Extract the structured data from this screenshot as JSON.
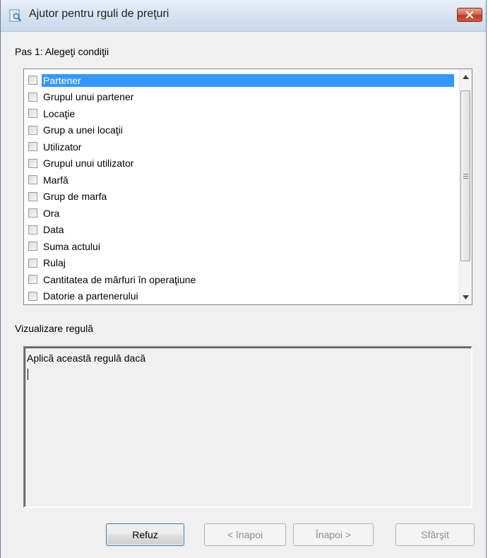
{
  "window": {
    "title": "Ajutor pentru rguli de preţuri"
  },
  "step": {
    "label": "Pas 1: Alegeţi condiţii"
  },
  "conditions": {
    "items": [
      {
        "label": "Partener",
        "checked": false,
        "selected": true
      },
      {
        "label": "Grupul unui partener",
        "checked": false,
        "selected": false
      },
      {
        "label": "Locaţie",
        "checked": false,
        "selected": false
      },
      {
        "label": "Grup a unei locaţii",
        "checked": false,
        "selected": false
      },
      {
        "label": "Utilizator",
        "checked": false,
        "selected": false
      },
      {
        "label": "Grupul unui utilizator",
        "checked": false,
        "selected": false
      },
      {
        "label": "Marfă",
        "checked": false,
        "selected": false
      },
      {
        "label": "Grup de marfa",
        "checked": false,
        "selected": false
      },
      {
        "label": "Ora",
        "checked": false,
        "selected": false
      },
      {
        "label": "Data",
        "checked": false,
        "selected": false
      },
      {
        "label": "Suma actului",
        "checked": false,
        "selected": false
      },
      {
        "label": "Rulaj",
        "checked": false,
        "selected": false
      },
      {
        "label": "Cantitatea de mărfuri în operaţiune",
        "checked": false,
        "selected": false
      },
      {
        "label": "Datorie a partenerului",
        "checked": false,
        "selected": false
      }
    ]
  },
  "preview": {
    "label": "Vizualizare regulă",
    "text": "Aplică această regulă dacă"
  },
  "buttons": {
    "cancel": "Refuz",
    "back": "< înapoi",
    "next": "Înapoi >",
    "finish": "Sfârşit"
  },
  "colors": {
    "selection": "#3399ff",
    "dialog_bg": "#f0f0f0"
  }
}
